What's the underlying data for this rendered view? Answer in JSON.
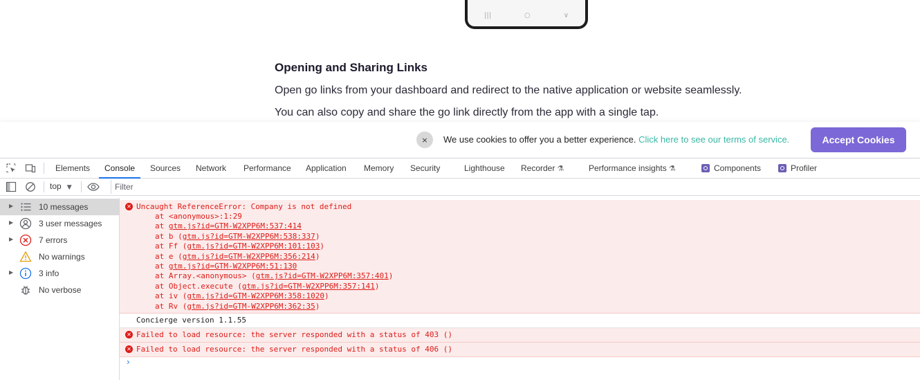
{
  "webpage": {
    "heading": "Opening and Sharing Links",
    "para1": "Open go links from your dashboard and redirect to the native application or website seamlessly.",
    "para2": "You can also copy and share the go link directly from the app with a single tap.",
    "phone_nav": [
      "|||",
      "○",
      "∨"
    ]
  },
  "cookie_banner": {
    "close_glyph": "×",
    "text": "We use cookies to offer you a better experience.",
    "link_text": "Click here to see our terms of service.",
    "accept_label": "Accept Cookies",
    "accept_color": "#7c68d6",
    "link_color": "#3ab7a4"
  },
  "devtools": {
    "tabs": [
      "Elements",
      "Console",
      "Sources",
      "Network",
      "Performance",
      "Application",
      "Memory",
      "Security",
      "Lighthouse",
      "Recorder",
      "Performance insights",
      "Components",
      "Profiler"
    ],
    "active_tab": "Console",
    "toolbar": {
      "context": "top",
      "filter_placeholder": "Filter"
    },
    "sidebar": [
      {
        "label": "10 messages",
        "icon": "list-icon",
        "selected": true
      },
      {
        "label": "3 user messages",
        "icon": "user-icon"
      },
      {
        "label": "7 errors",
        "icon": "error-icon"
      },
      {
        "label": "No warnings",
        "icon": "warning-icon"
      },
      {
        "label": "3 info",
        "icon": "info-icon"
      },
      {
        "label": "No verbose",
        "icon": "bug-icon"
      }
    ],
    "messages": {
      "error1": {
        "title": "Uncaught ReferenceError: Company is not defined",
        "stack": [
          {
            "pre": "at <anonymous>:1:29",
            "link": "",
            "post": ""
          },
          {
            "pre": "at ",
            "link": "gtm.js?id=GTM-W2XPP6M:537:414",
            "post": ""
          },
          {
            "pre": "at b (",
            "link": "gtm.js?id=GTM-W2XPP6M:538:337",
            "post": ")"
          },
          {
            "pre": "at Ff (",
            "link": "gtm.js?id=GTM-W2XPP6M:101:103",
            "post": ")"
          },
          {
            "pre": "at e (",
            "link": "gtm.js?id=GTM-W2XPP6M:356:214",
            "post": ")"
          },
          {
            "pre": "at ",
            "link": "gtm.js?id=GTM-W2XPP6M:51:130",
            "post": ""
          },
          {
            "pre": "at Array.<anonymous> (",
            "link": "gtm.js?id=GTM-W2XPP6M:357:401",
            "post": ")"
          },
          {
            "pre": "at Object.execute (",
            "link": "gtm.js?id=GTM-W2XPP6M:357:141",
            "post": ")"
          },
          {
            "pre": "at iv (",
            "link": "gtm.js?id=GTM-W2XPP6M:358:1020",
            "post": ")"
          },
          {
            "pre": "at Rv (",
            "link": "gtm.js?id=GTM-W2XPP6M:362:35",
            "post": ")"
          }
        ]
      },
      "log1": "Concierge version 1.1.55",
      "error2": "Failed to load resource: the server responded with a status of 403 ()",
      "error3": "Failed to load resource: the server responded with a status of 406 ()",
      "prompt": "›"
    }
  }
}
